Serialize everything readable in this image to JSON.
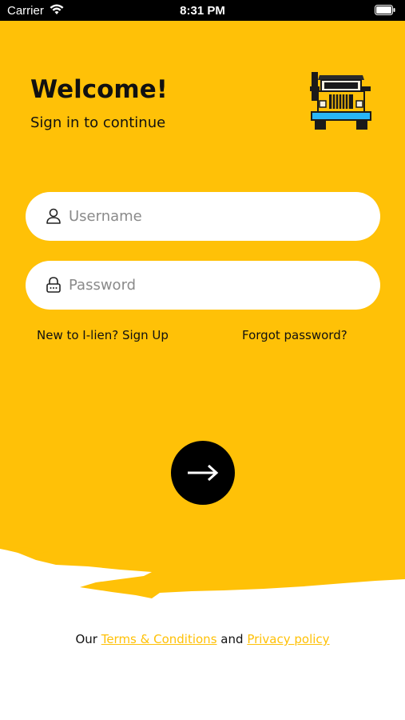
{
  "status_bar": {
    "carrier": "Carrier",
    "time": "8:31 PM"
  },
  "colors": {
    "accent": "#FFC107",
    "text": "#111111",
    "placeholder": "#8A8A8A"
  },
  "header": {
    "title": "Welcome!",
    "subtitle": "Sign in to continue"
  },
  "form": {
    "username": {
      "placeholder": "Username",
      "value": "",
      "icon": "user-icon"
    },
    "password": {
      "placeholder": "Password",
      "value": "",
      "icon": "lock-icon"
    },
    "signup_link": "New to I-lien? Sign Up",
    "forgot_link": "Forgot password?",
    "submit_icon": "arrow-right-icon"
  },
  "footer": {
    "prefix": "Our",
    "terms": "Terms & Conditions",
    "middle": "and",
    "privacy": "Privacy policy"
  }
}
